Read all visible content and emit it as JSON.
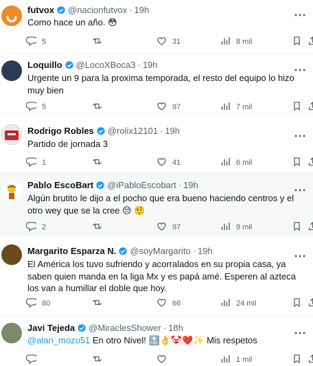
{
  "tweets": [
    {
      "name": "futvox",
      "handle": "@nacionfutvox",
      "time": "19h",
      "text": "Como hace un año. 😳",
      "replies": "5",
      "retweets": "",
      "likes": "31",
      "views": "8 mil",
      "avatar_color": "#f08a24"
    },
    {
      "name": "Loquillo",
      "handle": "@LocoXBoca3",
      "time": "19h",
      "text": "Urgente un 9 para la proxima temporada, el resto del equipo lo hizo muy bien",
      "replies": "5",
      "retweets": "",
      "likes": "97",
      "views": "7 mil",
      "avatar_color": "#2c3a55"
    },
    {
      "name": "Rodrigo Robles",
      "handle": "@rolix12101",
      "time": "19h",
      "text": "Partido de jornada 3",
      "replies": "1",
      "retweets": "",
      "likes": "41",
      "views": "6 mil",
      "avatar_color": "#c4262b"
    },
    {
      "name": "Pablo EscoBart",
      "handle": "@iPabloEscobart",
      "time": "19h",
      "text": "Algún brutito le dijo a el pocho que era bueno haciendo centros y el otro wey que se la cree 😒 🤨",
      "replies": "2",
      "retweets": "",
      "likes": "97",
      "views": "9 mil",
      "avatar_color": "#f3c623"
    },
    {
      "name": "Margarito Esparza N.",
      "handle": "@soyMargarito",
      "time": "19h",
      "text": "El América los tuvo sufriendo y acorralados en su propia casa, ya saben quien manda en la liga Mx y es papá amé. Esperen al azteca los van a humillar el doble que hoy.",
      "replies": "80",
      "retweets": "",
      "likes": "66",
      "views": "24 mil",
      "avatar_color": "#6b4a1c"
    },
    {
      "name": "Javi Tejeda",
      "handle": "@MiraclesShower",
      "time": "18h",
      "mention": "@alan_mozo51",
      "text": " En otro Nivel! 🔝👌🤡❤️✨ Mis respetos",
      "replies": "",
      "retweets": "",
      "likes": "",
      "views": "1 mil",
      "avatar_color": "#7a8a6a"
    }
  ],
  "colors": {
    "verified": "#1d9bf0",
    "secondary_text": "#536471",
    "highlight_bg": "#f7f9f9"
  },
  "icons": [
    "more-icon",
    "reply-icon",
    "retweet-icon",
    "like-icon",
    "views-icon",
    "bookmark-icon",
    "share-icon",
    "verified-badge-icon"
  ]
}
